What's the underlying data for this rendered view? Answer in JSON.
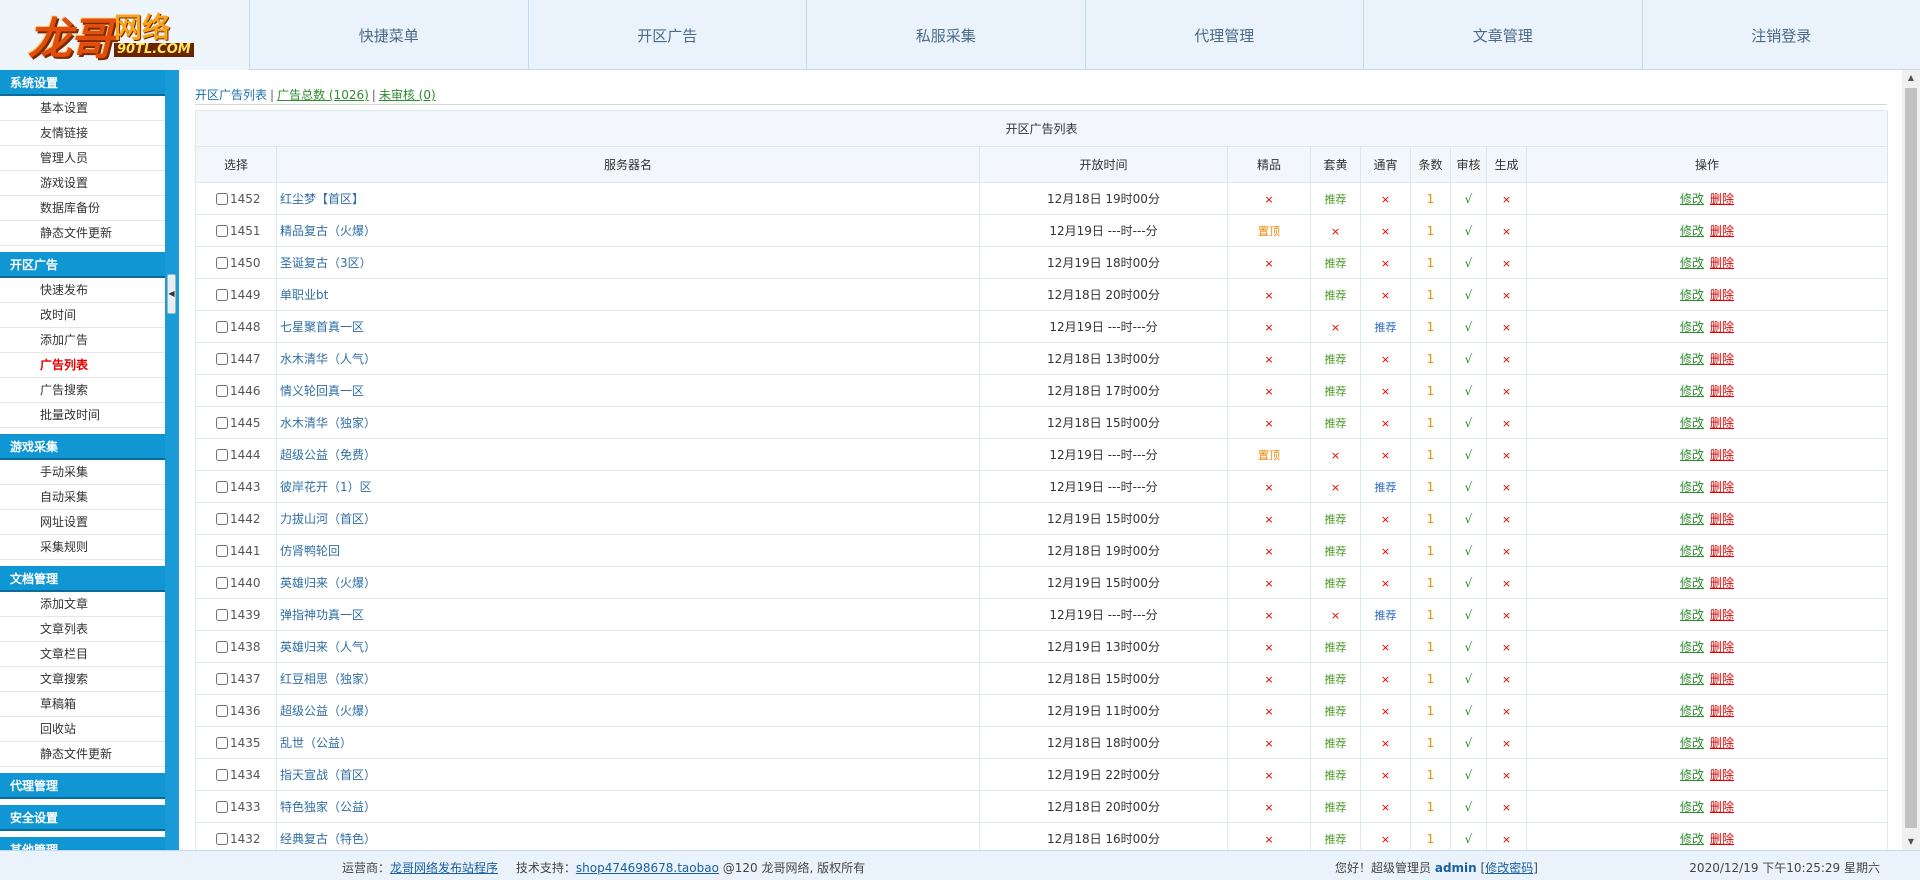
{
  "logo": {
    "main": "龙哥",
    "net": "网络",
    "url": "90TL.COM"
  },
  "topnav": [
    "快捷菜单",
    "开区广告",
    "私服采集",
    "代理管理",
    "文章管理",
    "注销登录"
  ],
  "sidebar": {
    "groups": [
      {
        "title": "系统设置",
        "items": [
          "基本设置",
          "友情链接",
          "管理人员",
          "游戏设置",
          "数据库备份",
          "静态文件更新"
        ]
      },
      {
        "title": "开区广告",
        "items": [
          "快速发布",
          "改时间",
          "添加广告",
          "广告列表",
          "广告搜索",
          "批量改时间"
        ],
        "active": "广告列表"
      },
      {
        "title": "游戏采集",
        "items": [
          "手动采集",
          "自动采集",
          "网址设置",
          "采集规则"
        ]
      },
      {
        "title": "文档管理",
        "items": [
          "添加文章",
          "文章列表",
          "文章栏目",
          "文章搜索",
          "草稿箱",
          "回收站",
          "静态文件更新"
        ]
      },
      {
        "title": "代理管理",
        "items": []
      },
      {
        "title": "安全设置",
        "items": []
      },
      {
        "title": "其他管理",
        "items": []
      }
    ]
  },
  "crumb": {
    "current": "开区广告列表",
    "total_link": "广告总数 (1026)",
    "unreviewed_link": "未审核 (0)",
    "sep": "|"
  },
  "table": {
    "caption": "开区广告列表",
    "headers": [
      "选择",
      "服务器名",
      "开放时间",
      "精品",
      "套黄",
      "通宵",
      "条数",
      "审核",
      "生成",
      "操作"
    ],
    "edit_label": "修改",
    "delete_label": "删除",
    "rows": [
      {
        "id": "1452",
        "name": "红尘梦【首区】",
        "time": "12月18日 19时00分",
        "jp": "×",
        "th": "推荐",
        "tx": "×",
        "count": "1",
        "review": "√",
        "gen": "×"
      },
      {
        "id": "1451",
        "name": "精品复古（火爆）",
        "time": "12月19日 ---时---分",
        "jp": "置顶",
        "th": "×",
        "tx": "×",
        "count": "1",
        "review": "√",
        "gen": "×"
      },
      {
        "id": "1450",
        "name": "圣诞复古（3区）",
        "time": "12月19日 18时00分",
        "jp": "×",
        "th": "推荐",
        "tx": "×",
        "count": "1",
        "review": "√",
        "gen": "×"
      },
      {
        "id": "1449",
        "name": "单职业bt",
        "time": "12月18日 20时00分",
        "jp": "×",
        "th": "推荐",
        "tx": "×",
        "count": "1",
        "review": "√",
        "gen": "×"
      },
      {
        "id": "1448",
        "name": "七星聚首真一区",
        "time": "12月19日 ---时---分",
        "jp": "×",
        "th": "×",
        "tx": "推荐",
        "count": "1",
        "review": "√",
        "gen": "×"
      },
      {
        "id": "1447",
        "name": "水木清华（人气）",
        "time": "12月18日 13时00分",
        "jp": "×",
        "th": "推荐",
        "tx": "×",
        "count": "1",
        "review": "√",
        "gen": "×"
      },
      {
        "id": "1446",
        "name": "情义轮回真一区",
        "time": "12月18日 17时00分",
        "jp": "×",
        "th": "推荐",
        "tx": "×",
        "count": "1",
        "review": "√",
        "gen": "×"
      },
      {
        "id": "1445",
        "name": "水木清华（独家）",
        "time": "12月18日 15时00分",
        "jp": "×",
        "th": "推荐",
        "tx": "×",
        "count": "1",
        "review": "√",
        "gen": "×"
      },
      {
        "id": "1444",
        "name": "超级公益（免费）",
        "time": "12月19日 ---时---分",
        "jp": "置顶",
        "th": "×",
        "tx": "×",
        "count": "1",
        "review": "√",
        "gen": "×"
      },
      {
        "id": "1443",
        "name": "彼岸花开（1）区",
        "time": "12月19日 ---时---分",
        "jp": "×",
        "th": "×",
        "tx": "推荐",
        "count": "1",
        "review": "√",
        "gen": "×"
      },
      {
        "id": "1442",
        "name": "力拔山河（首区）",
        "time": "12月19日 15时00分",
        "jp": "×",
        "th": "推荐",
        "tx": "×",
        "count": "1",
        "review": "√",
        "gen": "×"
      },
      {
        "id": "1441",
        "name": "仿肾鸭轮回",
        "time": "12月18日 19时00分",
        "jp": "×",
        "th": "推荐",
        "tx": "×",
        "count": "1",
        "review": "√",
        "gen": "×"
      },
      {
        "id": "1440",
        "name": "英雄归来（火爆）",
        "time": "12月19日 15时00分",
        "jp": "×",
        "th": "推荐",
        "tx": "×",
        "count": "1",
        "review": "√",
        "gen": "×"
      },
      {
        "id": "1439",
        "name": "弹指神功真一区",
        "time": "12月19日 ---时---分",
        "jp": "×",
        "th": "×",
        "tx": "推荐",
        "count": "1",
        "review": "√",
        "gen": "×"
      },
      {
        "id": "1438",
        "name": "英雄归来（人气）",
        "time": "12月19日 13时00分",
        "jp": "×",
        "th": "推荐",
        "tx": "×",
        "count": "1",
        "review": "√",
        "gen": "×"
      },
      {
        "id": "1437",
        "name": "红豆相思（独家）",
        "time": "12月18日 15时00分",
        "jp": "×",
        "th": "推荐",
        "tx": "×",
        "count": "1",
        "review": "√",
        "gen": "×"
      },
      {
        "id": "1436",
        "name": "超级公益（火爆）",
        "time": "12月19日 11时00分",
        "jp": "×",
        "th": "推荐",
        "tx": "×",
        "count": "1",
        "review": "√",
        "gen": "×"
      },
      {
        "id": "1435",
        "name": "乱世（公益）",
        "time": "12月18日 18时00分",
        "jp": "×",
        "th": "推荐",
        "tx": "×",
        "count": "1",
        "review": "√",
        "gen": "×"
      },
      {
        "id": "1434",
        "name": "指天宣战（首区）",
        "time": "12月19日 22时00分",
        "jp": "×",
        "th": "推荐",
        "tx": "×",
        "count": "1",
        "review": "√",
        "gen": "×"
      },
      {
        "id": "1433",
        "name": "特色独家（公益）",
        "time": "12月18日 20时00分",
        "jp": "×",
        "th": "推荐",
        "tx": "×",
        "count": "1",
        "review": "√",
        "gen": "×"
      },
      {
        "id": "1432",
        "name": "经典复古（特色）",
        "time": "12月18日 16时00分",
        "jp": "×",
        "th": "推荐",
        "tx": "×",
        "count": "1",
        "review": "√",
        "gen": "×"
      }
    ]
  },
  "footer": {
    "operator_label": "运营商：",
    "operator_link": "龙哥网络发布站程序",
    "support_label": "技术支持：",
    "support_link": "shop474698678.taobao",
    "copyright": "@120 龙哥网络, 版权所有",
    "greeting": "您好！超级管理员",
    "username": "admin",
    "bracket_open": "[",
    "change_pwd": "修改密码",
    "bracket_close": "]",
    "datetime": "2020/12/19 下午10:25:29 星期六"
  },
  "colors": {
    "accent": "#1096d3",
    "active": "#e40000",
    "link_green": "#2e8b2e"
  }
}
